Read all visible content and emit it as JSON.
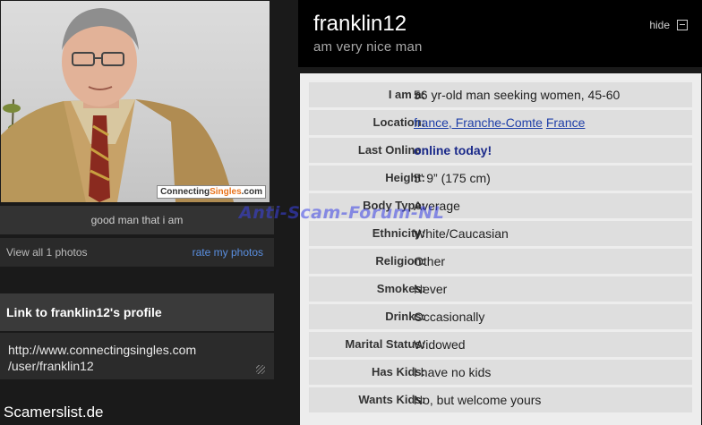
{
  "left": {
    "photo": {
      "watermark_prefix": "Connecting",
      "watermark_accent": "Singles",
      "watermark_suffix": ".com"
    },
    "caption": "good man that i am",
    "view_all": "View all 1 photos",
    "rate": "rate my photos",
    "link_heading": "Link to franklin12's profile",
    "link_line1": "http://www.connectingsingles.com",
    "link_line2": "/user/franklin12",
    "footer_text": "Scamerslist.de"
  },
  "header": {
    "name": "franklin12",
    "tagline": "am very nice man",
    "hide_label": "hide"
  },
  "details": {
    "iam_label": "I am a:",
    "iam_value": "56 yr-old man seeking women, 45-60",
    "location_label": "Location:",
    "location_link1": "france, Franche-Comte",
    "location_link2": "France",
    "online_label": "Last Online:",
    "online_value": "online today!",
    "height_label": "Height:",
    "height_value": "5’ 9”  (175 cm)",
    "body_label": "Body Type:",
    "body_value": "Average",
    "ethnicity_label": "Ethnicity:",
    "ethnicity_value": "White/Caucasian",
    "religion_label": "Religion:",
    "religion_value": "Other",
    "smokes_label": "Smokes:",
    "smokes_value": "Never",
    "drinks_label": "Drinks:",
    "drinks_value": "Occasionally",
    "marital_label": "Marital Status:",
    "marital_value": "Widowed",
    "haskids_label": "Has Kids:",
    "haskids_value": "I have no kids",
    "wantskids_label": "Wants Kids:",
    "wantskids_value": "No, but welcome yours"
  },
  "overlay_watermark": "Anti-Scam-Forum-NL",
  "colors": {
    "link": "#1f3fa8",
    "rate_link": "#5a8fe0",
    "watermark_accent": "#e8731c",
    "overlay": "#3b43e6"
  }
}
